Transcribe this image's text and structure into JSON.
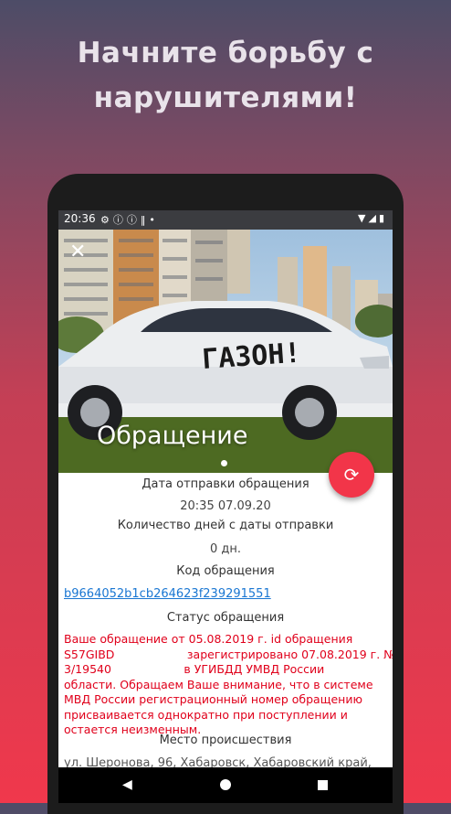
{
  "promo": {
    "headline_line1": "Начните борьбу с",
    "headline_line2": "нарушителями!"
  },
  "statusbar": {
    "time": "20:36",
    "left_icons": [
      "settings-icon",
      "info-icon",
      "info-icon",
      "signal-bars-icon",
      "dot-icon"
    ],
    "right_icons": [
      "wifi-icon",
      "cell-signal-icon",
      "battery-icon"
    ]
  },
  "hero": {
    "title": "Обращение",
    "graffiti_text": "ГАЗОН!",
    "close_icon": "close-icon"
  },
  "fab": {
    "icon": "refresh-icon",
    "color": "#f23549"
  },
  "details": {
    "sent_date_label": "Дата отправки обращения",
    "sent_date_value": "20:35 07.09.20",
    "days_label": "Количество дней с даты отправки",
    "days_value": "0 дн.",
    "code_label": "Код обращения",
    "code_value": "b9664052b1cb264623f239291551",
    "status_label": "Статус обращения",
    "status_line1": "Ваше обращение от 05.08.2019 г. id обращения",
    "status_line2": "S57GIBD                    зарегистрировано 07.08.2019 г. №",
    "status_line3": "3/19540                    в УГИБДД УМВД России",
    "status_line4": "области. Обращаем Ваше внимание, что в системе",
    "status_line5": "МВД России регистрационный номер обращению",
    "status_line6": "присваивается однократно при поступлении и",
    "status_line7": "остается неизменным.",
    "place_label": "Место происшествия",
    "place_value": "ул. Шеронова, 96, Хабаровск, Хабаровский край,"
  },
  "colors": {
    "accent": "#f23549",
    "status_text": "#e0001b",
    "link": "#1976d2"
  }
}
